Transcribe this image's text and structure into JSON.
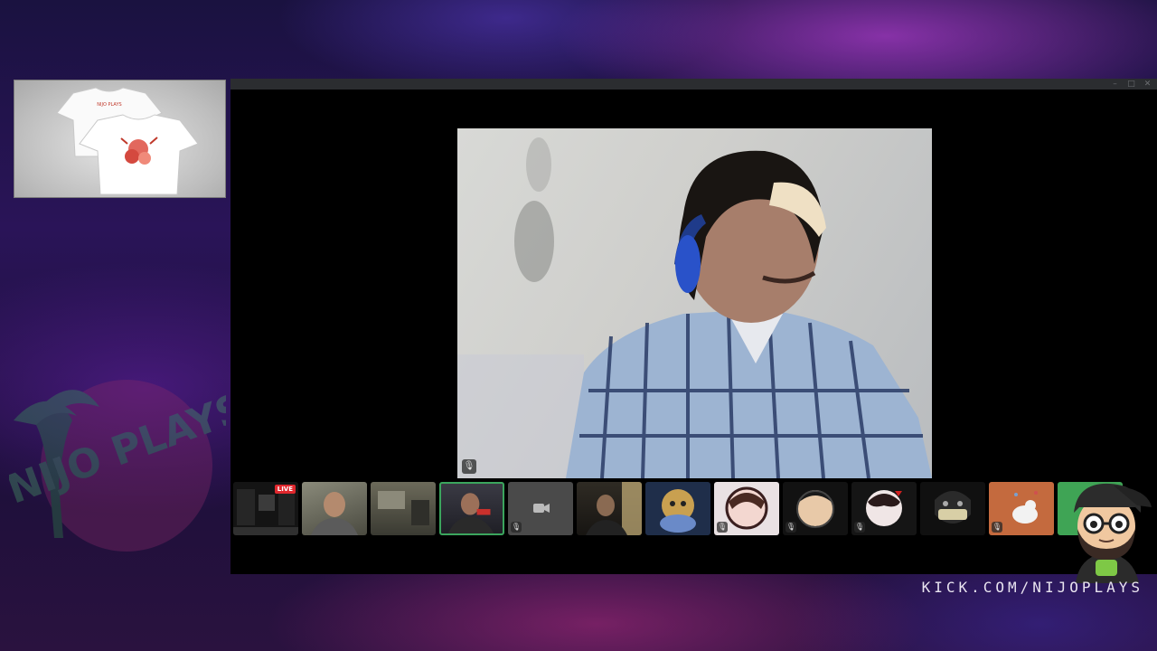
{
  "merch": {
    "shirt_back_text": "NIJO PLAYS"
  },
  "watermark": {
    "logo_text": "NIJO PLAYS"
  },
  "window": {
    "controls": [
      "–",
      "□",
      "✕"
    ]
  },
  "main_video": {
    "mute_glyph": "🎙"
  },
  "thumbnails": [
    {
      "kind": "screen",
      "live": true,
      "live_label": "LIVE"
    },
    {
      "kind": "camera"
    },
    {
      "kind": "camera"
    },
    {
      "kind": "camera",
      "active": true
    },
    {
      "kind": "camera-off"
    },
    {
      "kind": "camera"
    },
    {
      "kind": "avatar"
    },
    {
      "kind": "avatar"
    },
    {
      "kind": "avatar"
    },
    {
      "kind": "avatar"
    },
    {
      "kind": "avatar"
    },
    {
      "kind": "avatar"
    },
    {
      "kind": "avatar"
    }
  ],
  "footer": {
    "channel_url": "KICK.COM/NIJOPLAYS"
  },
  "colors": {
    "live_red": "#e0282e",
    "speaking_green": "#3ba55d",
    "window_bar": "#2b2d30"
  }
}
